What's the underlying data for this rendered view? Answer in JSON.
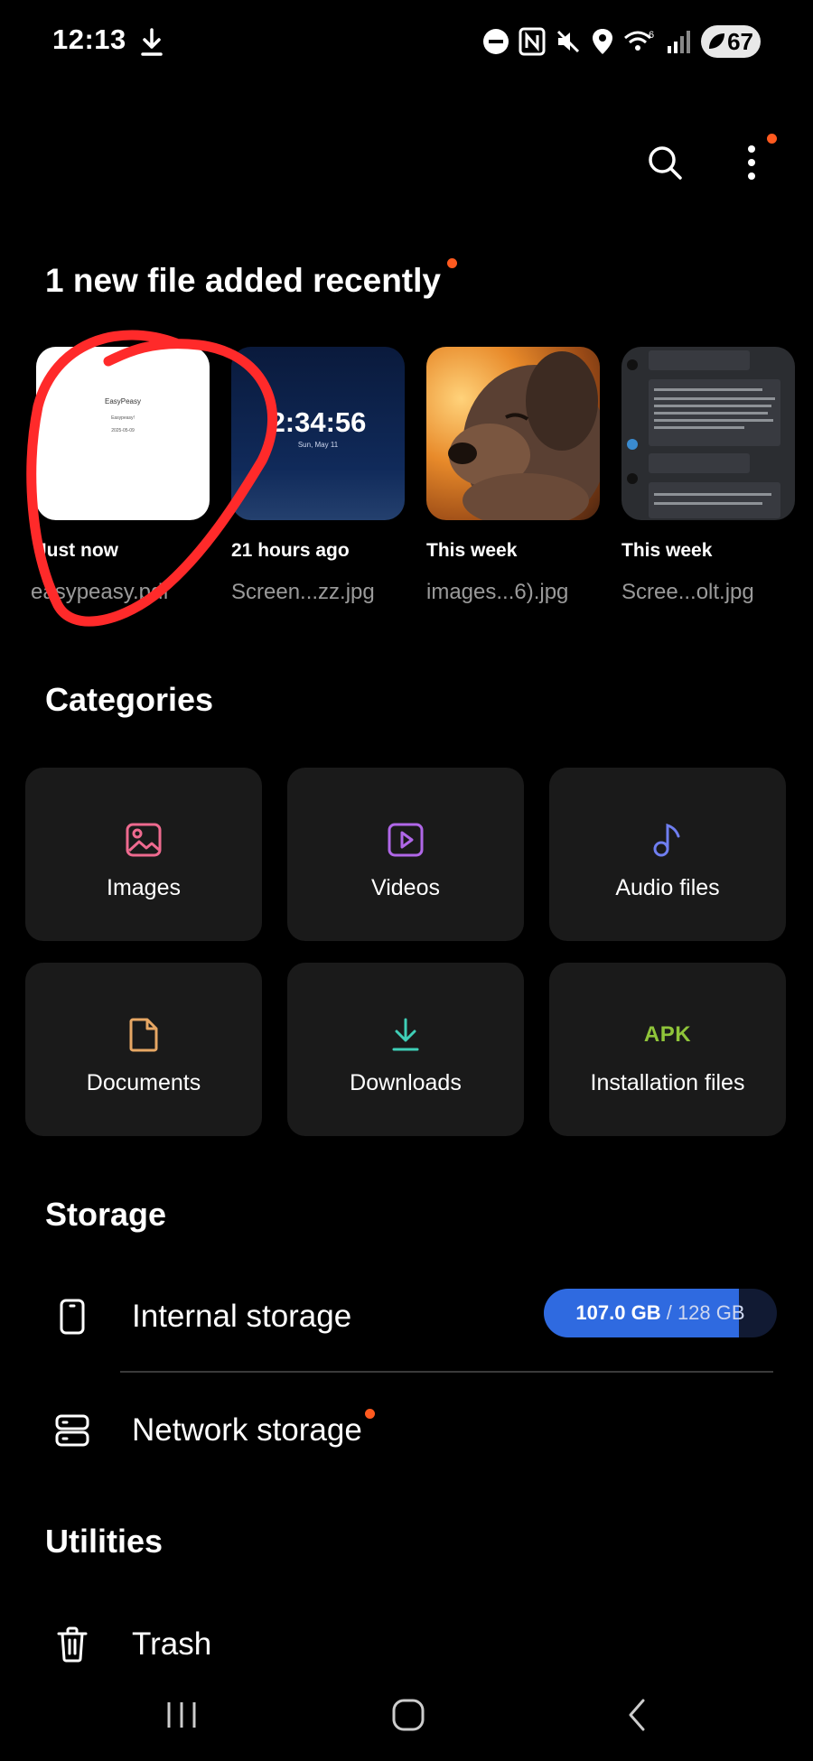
{
  "status_bar": {
    "time": "12:13",
    "battery": "67",
    "icons": [
      "download-icon",
      "do-not-disturb-icon",
      "nfc-icon",
      "mute-icon",
      "location-icon",
      "wifi-6-icon",
      "signal-icon",
      "battery-icon"
    ]
  },
  "top_actions": {
    "search_icon": "search-icon",
    "more_icon": "more-vertical-icon",
    "more_has_notification": true
  },
  "recent": {
    "title": "1 new file added recently",
    "files": [
      {
        "when": "Just now",
        "name": "easypeasy.pdf",
        "thumb": "pdf",
        "thumb_lines": [
          "EasyPeasy",
          "Easypeasy!",
          "2025-05-09"
        ]
      },
      {
        "when": "21 hours ago",
        "name": "Screen...zz.jpg",
        "thumb": "clock",
        "thumb_time": "2:34:56",
        "thumb_date": "Sun, May 11"
      },
      {
        "when": "This week",
        "name": "images...6).jpg",
        "thumb": "dog"
      },
      {
        "when": "This week",
        "name": "Scree...olt.jpg",
        "thumb": "chat"
      }
    ]
  },
  "categories": {
    "title": "Categories",
    "items": [
      {
        "label": "Images",
        "icon": "image-icon",
        "color": "#ee6a8f"
      },
      {
        "label": "Videos",
        "icon": "video-icon",
        "color": "#b067e8"
      },
      {
        "label": "Audio files",
        "icon": "music-note-icon",
        "color": "#6f7ef0"
      },
      {
        "label": "Documents",
        "icon": "document-icon",
        "color": "#e7a764"
      },
      {
        "label": "Downloads",
        "icon": "download-icon",
        "color": "#3fcfb7"
      },
      {
        "label": "Installation files",
        "icon": "apk-icon",
        "icon_text": "APK",
        "color": "#8fc43a"
      }
    ]
  },
  "storage": {
    "title": "Storage",
    "internal_label": "Internal storage",
    "used": "107.0 GB",
    "total": "/ 128 GB",
    "used_fraction": 0.836,
    "network_label": "Network storage"
  },
  "utilities": {
    "title": "Utilities",
    "trash_label": "Trash"
  },
  "nav": {
    "icons": [
      "recent-apps-icon",
      "home-icon",
      "back-icon"
    ]
  },
  "colors": {
    "accent_dot": "#ff5a1f",
    "tile_bg": "#1a1a1a",
    "storage_fill": "#2f6ae0"
  }
}
